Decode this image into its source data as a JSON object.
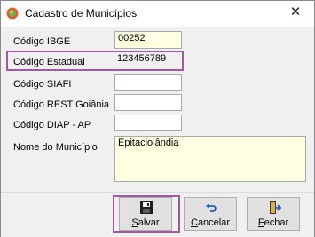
{
  "window": {
    "title": "Cadastro de Municípios",
    "close_glyph": "✕"
  },
  "form": {
    "codigo_ibge": {
      "label": "Código IBGE",
      "value": "00252"
    },
    "codigo_estadual": {
      "label": "Código Estadual",
      "value": "123456789"
    },
    "codigo_siafi": {
      "label": "Código SIAFI",
      "value": ""
    },
    "codigo_rest_goiania": {
      "label": "Código REST Goiânia",
      "value": ""
    },
    "codigo_diap_ap": {
      "label": "Código DIAP - AP",
      "value": ""
    },
    "nome_municipio": {
      "label": "Nome do Município",
      "value": "Epitaciolândia"
    }
  },
  "buttons": {
    "salvar": {
      "first": "S",
      "rest": "alvar",
      "icon": "floppy-disk-icon"
    },
    "cancelar": {
      "first": "C",
      "rest": "ancelar",
      "icon": "undo-arrow-icon"
    },
    "fechar": {
      "first": "F",
      "rest": "echar",
      "icon": "exit-door-icon"
    }
  },
  "colors": {
    "highlight": "#a05aa0",
    "field_yellow": "#ffffe1"
  }
}
